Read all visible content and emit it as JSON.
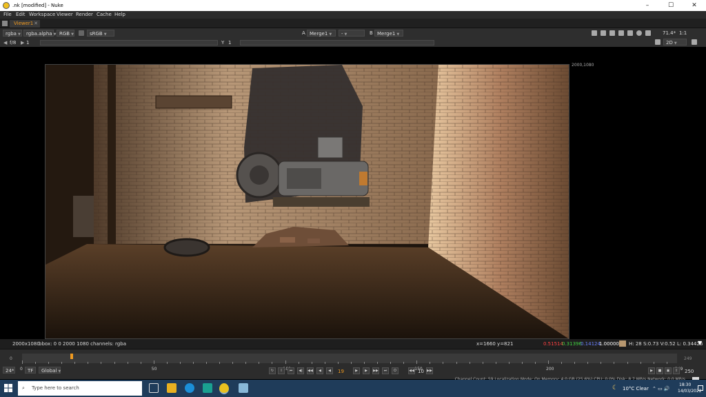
{
  "window": {
    "title": ".nk [modified] - Nuke",
    "controls": {
      "minimize": "–",
      "maximize": "☐",
      "close": "✕"
    }
  },
  "menubar": {
    "items": [
      "File",
      "Edit",
      "Workspace",
      "Viewer",
      "Render",
      "Cache",
      "Help"
    ]
  },
  "tabs": [
    {
      "label": "Viewer1",
      "close": "✕"
    }
  ],
  "viewer_toolbar": {
    "channels": "rgba",
    "alpha": "rgba.alpha",
    "display_channel": "RGB",
    "colorspace": "sRGB",
    "input_a_letter": "A",
    "input_a": "Merge1",
    "compare_mode": "-",
    "input_b_letter": "B",
    "input_b": "Merge1",
    "zoom": "71.4*",
    "proxy": "1:1"
  },
  "viewer_toolbar2": {
    "fstop": "f/8",
    "gain": "1",
    "gamma_letter": "Y",
    "gamma": "1",
    "view_mode": "2D"
  },
  "viewport": {
    "format_label": "2000,1080"
  },
  "infobar": {
    "format": "2000x1080",
    "bbox": "bbox: 0 0 2000 1080 channels: rgba",
    "coords": "x=1660 y=821",
    "r": "0.51514",
    "g": "0.31396",
    "b": "0.14124",
    "a": "1.00000",
    "swatch_color": "#b89870",
    "hsvl": "H: 28 S:0.73 V:0.52  L: 0.34426"
  },
  "timeline": {
    "in_frame": "0",
    "out_frame": "249",
    "tick_labels": [
      "0",
      "50",
      "100",
      "150",
      "200",
      "249"
    ],
    "fps": "24*",
    "tf": "TF",
    "range": "Global",
    "current_frame": "19",
    "increment": "10",
    "end_frame": "250",
    "playhead_frame": 19,
    "total_frames": 249
  },
  "status": {
    "text": "Channel Count: 59  Localization Mode: On  Memory: 4.0 GB (25.6%)  CPU: 0.0%  Disk: 8.7 MB/s  Network: 0.0 MB/s"
  },
  "taskbar": {
    "search_placeholder": "Type here to search",
    "weather": "10°C  Clear",
    "time": "18:30",
    "date": "14/03/2022"
  },
  "colors": {
    "accent": "#f09a20",
    "red": "#ff4040",
    "green": "#40d040",
    "blue": "#5070ff"
  }
}
